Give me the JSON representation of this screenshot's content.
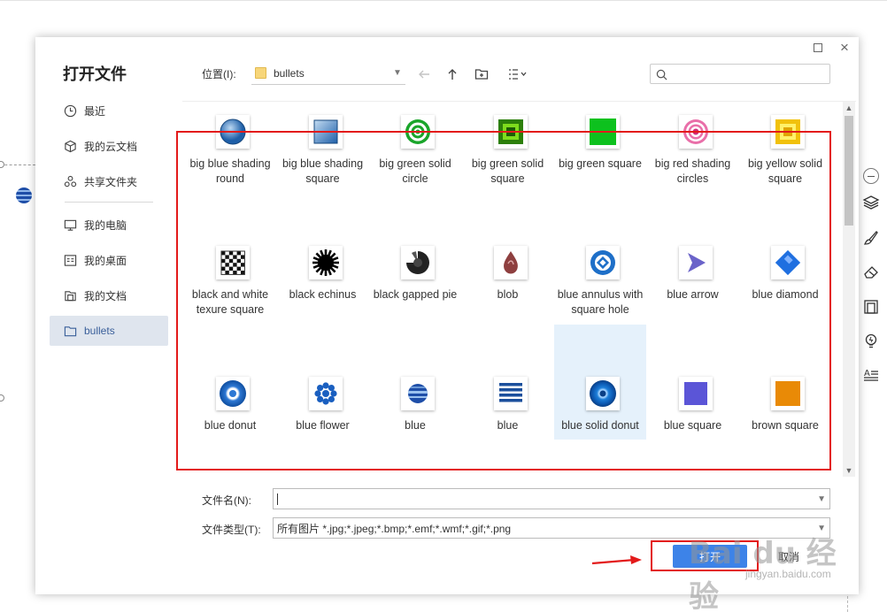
{
  "dialog": {
    "title": "打开文件",
    "window_buttons": {
      "maximize": "maximize-icon",
      "close": "×"
    }
  },
  "sidebar": {
    "items": [
      {
        "label": "最近",
        "icon": "clock-icon"
      },
      {
        "label": "我的云文档",
        "icon": "cube-icon"
      },
      {
        "label": "共享文件夹",
        "icon": "share-folder-icon"
      },
      {
        "label": "我的电脑",
        "icon": "monitor-icon"
      },
      {
        "label": "我的桌面",
        "icon": "desktop-icon"
      },
      {
        "label": "我的文档",
        "icon": "documents-icon"
      },
      {
        "label": "bullets",
        "icon": "folder-icon",
        "active": true
      }
    ]
  },
  "location": {
    "label": "位置(I):",
    "value": "bullets"
  },
  "search": {
    "placeholder": ""
  },
  "files": [
    {
      "label": "big blue shading round",
      "icon": "blue-shaded-round"
    },
    {
      "label": "big blue shading square",
      "icon": "blue-shaded-square"
    },
    {
      "label": "big green solid circle",
      "icon": "green-target-circle"
    },
    {
      "label": "big green solid square",
      "icon": "green-square-frame"
    },
    {
      "label": "big green square",
      "icon": "green-square"
    },
    {
      "label": "big red shading circles",
      "icon": "red-target-circles"
    },
    {
      "label": "big yellow solid square",
      "icon": "yellow-square-frame"
    },
    {
      "label": "black and white texure square",
      "icon": "checker-square"
    },
    {
      "label": "black echinus",
      "icon": "black-burst"
    },
    {
      "label": "black gapped pie",
      "icon": "black-pie"
    },
    {
      "label": "blob",
      "icon": "blob-drop"
    },
    {
      "label": "blue annulus with square hole",
      "icon": "blue-annulus-square"
    },
    {
      "label": "blue arrow",
      "icon": "blue-arrow"
    },
    {
      "label": "blue diamond",
      "icon": "blue-diamond"
    },
    {
      "label": "blue donut",
      "icon": "blue-donut"
    },
    {
      "label": "blue flower",
      "icon": "blue-flower"
    },
    {
      "label": "blue",
      "icon": "blue-striped-ball"
    },
    {
      "label": "blue",
      "icon": "blue-lines-square"
    },
    {
      "label": "blue solid donut",
      "icon": "blue-solid-donut",
      "selected": true
    },
    {
      "label": "blue square",
      "icon": "blue-square"
    },
    {
      "label": "brown square",
      "icon": "brown-square"
    }
  ],
  "filename": {
    "label": "文件名(N):",
    "value": ""
  },
  "filetype": {
    "label": "文件类型(T):",
    "value": "所有图片 *.jpg;*.jpeg;*.bmp;*.emf;*.wmf;*.gif;*.png"
  },
  "buttons": {
    "open": "打开",
    "cancel": "取消"
  },
  "watermark": {
    "logo": "Bai du 经验",
    "url": "jingyan.baidu.com"
  },
  "colors": {
    "highlight": "#e31a1a",
    "accent": "#3d83e8",
    "selected_bg": "#e5f1fb"
  }
}
